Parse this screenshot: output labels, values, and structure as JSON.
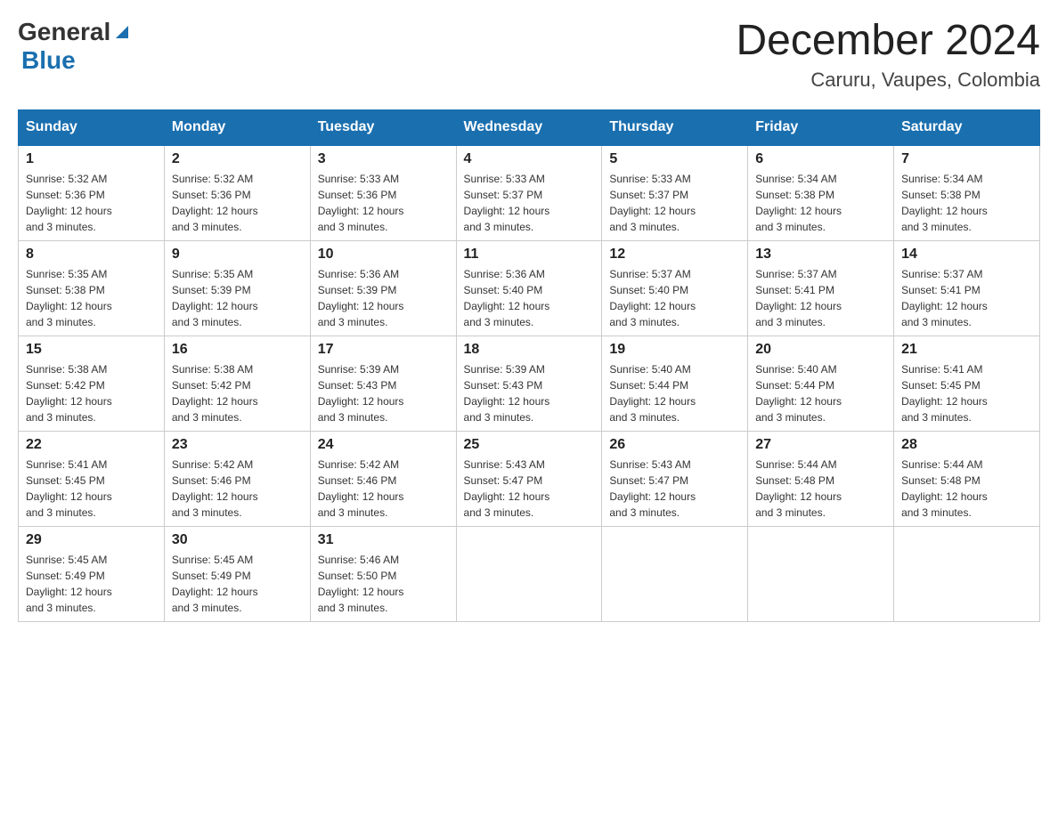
{
  "header": {
    "logo": {
      "general": "General",
      "blue": "Blue"
    },
    "title": "December 2024",
    "subtitle": "Caruru, Vaupes, Colombia"
  },
  "weekdays": [
    "Sunday",
    "Monday",
    "Tuesday",
    "Wednesday",
    "Thursday",
    "Friday",
    "Saturday"
  ],
  "weeks": [
    [
      {
        "day": "1",
        "sunrise": "5:32 AM",
        "sunset": "5:36 PM",
        "daylight": "12 hours and 3 minutes."
      },
      {
        "day": "2",
        "sunrise": "5:32 AM",
        "sunset": "5:36 PM",
        "daylight": "12 hours and 3 minutes."
      },
      {
        "day": "3",
        "sunrise": "5:33 AM",
        "sunset": "5:36 PM",
        "daylight": "12 hours and 3 minutes."
      },
      {
        "day": "4",
        "sunrise": "5:33 AM",
        "sunset": "5:37 PM",
        "daylight": "12 hours and 3 minutes."
      },
      {
        "day": "5",
        "sunrise": "5:33 AM",
        "sunset": "5:37 PM",
        "daylight": "12 hours and 3 minutes."
      },
      {
        "day": "6",
        "sunrise": "5:34 AM",
        "sunset": "5:38 PM",
        "daylight": "12 hours and 3 minutes."
      },
      {
        "day": "7",
        "sunrise": "5:34 AM",
        "sunset": "5:38 PM",
        "daylight": "12 hours and 3 minutes."
      }
    ],
    [
      {
        "day": "8",
        "sunrise": "5:35 AM",
        "sunset": "5:38 PM",
        "daylight": "12 hours and 3 minutes."
      },
      {
        "day": "9",
        "sunrise": "5:35 AM",
        "sunset": "5:39 PM",
        "daylight": "12 hours and 3 minutes."
      },
      {
        "day": "10",
        "sunrise": "5:36 AM",
        "sunset": "5:39 PM",
        "daylight": "12 hours and 3 minutes."
      },
      {
        "day": "11",
        "sunrise": "5:36 AM",
        "sunset": "5:40 PM",
        "daylight": "12 hours and 3 minutes."
      },
      {
        "day": "12",
        "sunrise": "5:37 AM",
        "sunset": "5:40 PM",
        "daylight": "12 hours and 3 minutes."
      },
      {
        "day": "13",
        "sunrise": "5:37 AM",
        "sunset": "5:41 PM",
        "daylight": "12 hours and 3 minutes."
      },
      {
        "day": "14",
        "sunrise": "5:37 AM",
        "sunset": "5:41 PM",
        "daylight": "12 hours and 3 minutes."
      }
    ],
    [
      {
        "day": "15",
        "sunrise": "5:38 AM",
        "sunset": "5:42 PM",
        "daylight": "12 hours and 3 minutes."
      },
      {
        "day": "16",
        "sunrise": "5:38 AM",
        "sunset": "5:42 PM",
        "daylight": "12 hours and 3 minutes."
      },
      {
        "day": "17",
        "sunrise": "5:39 AM",
        "sunset": "5:43 PM",
        "daylight": "12 hours and 3 minutes."
      },
      {
        "day": "18",
        "sunrise": "5:39 AM",
        "sunset": "5:43 PM",
        "daylight": "12 hours and 3 minutes."
      },
      {
        "day": "19",
        "sunrise": "5:40 AM",
        "sunset": "5:44 PM",
        "daylight": "12 hours and 3 minutes."
      },
      {
        "day": "20",
        "sunrise": "5:40 AM",
        "sunset": "5:44 PM",
        "daylight": "12 hours and 3 minutes."
      },
      {
        "day": "21",
        "sunrise": "5:41 AM",
        "sunset": "5:45 PM",
        "daylight": "12 hours and 3 minutes."
      }
    ],
    [
      {
        "day": "22",
        "sunrise": "5:41 AM",
        "sunset": "5:45 PM",
        "daylight": "12 hours and 3 minutes."
      },
      {
        "day": "23",
        "sunrise": "5:42 AM",
        "sunset": "5:46 PM",
        "daylight": "12 hours and 3 minutes."
      },
      {
        "day": "24",
        "sunrise": "5:42 AM",
        "sunset": "5:46 PM",
        "daylight": "12 hours and 3 minutes."
      },
      {
        "day": "25",
        "sunrise": "5:43 AM",
        "sunset": "5:47 PM",
        "daylight": "12 hours and 3 minutes."
      },
      {
        "day": "26",
        "sunrise": "5:43 AM",
        "sunset": "5:47 PM",
        "daylight": "12 hours and 3 minutes."
      },
      {
        "day": "27",
        "sunrise": "5:44 AM",
        "sunset": "5:48 PM",
        "daylight": "12 hours and 3 minutes."
      },
      {
        "day": "28",
        "sunrise": "5:44 AM",
        "sunset": "5:48 PM",
        "daylight": "12 hours and 3 minutes."
      }
    ],
    [
      {
        "day": "29",
        "sunrise": "5:45 AM",
        "sunset": "5:49 PM",
        "daylight": "12 hours and 3 minutes."
      },
      {
        "day": "30",
        "sunrise": "5:45 AM",
        "sunset": "5:49 PM",
        "daylight": "12 hours and 3 minutes."
      },
      {
        "day": "31",
        "sunrise": "5:46 AM",
        "sunset": "5:50 PM",
        "daylight": "12 hours and 3 minutes."
      },
      null,
      null,
      null,
      null
    ]
  ],
  "labels": {
    "sunrise": "Sunrise:",
    "sunset": "Sunset:",
    "daylight": "Daylight:"
  }
}
